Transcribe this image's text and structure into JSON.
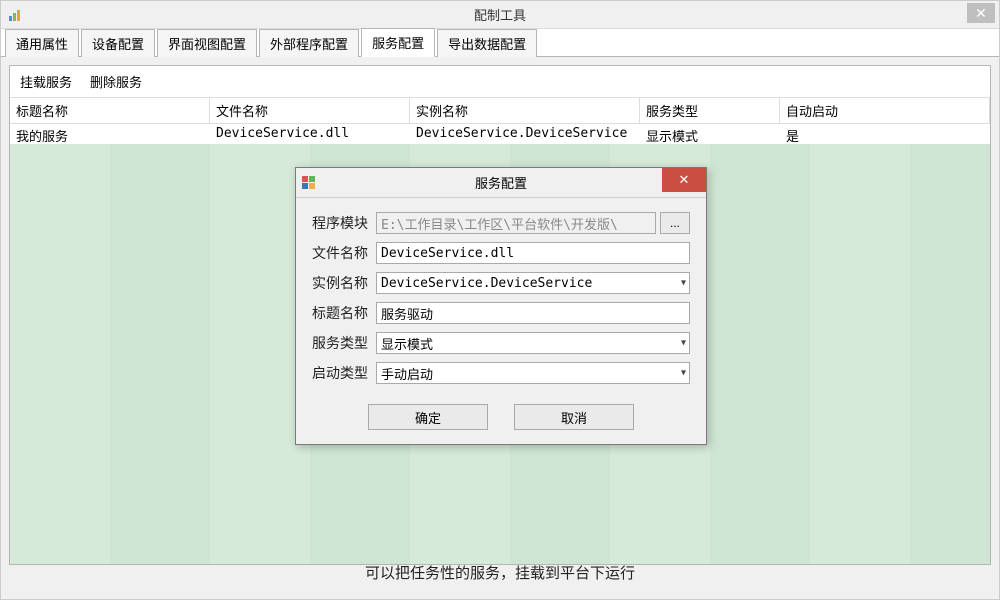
{
  "window": {
    "title": "配制工具"
  },
  "tabs": [
    {
      "label": "通用属性"
    },
    {
      "label": "设备配置"
    },
    {
      "label": "界面视图配置"
    },
    {
      "label": "外部程序配置"
    },
    {
      "label": "服务配置",
      "active": true
    },
    {
      "label": "导出数据配置"
    }
  ],
  "toolbar": {
    "mount": "挂载服务",
    "remove": "删除服务"
  },
  "grid": {
    "headers": {
      "title": "标题名称",
      "file": "文件名称",
      "instance": "实例名称",
      "type": "服务类型",
      "autostart": "自动启动"
    },
    "rows": [
      {
        "title": "我的服务",
        "file": "DeviceService.dll",
        "instance": "DeviceService.DeviceService",
        "type": "显示模式",
        "autostart": "是"
      }
    ]
  },
  "dialog": {
    "title": "服务配置",
    "labels": {
      "module": "程序模块",
      "file": "文件名称",
      "instance": "实例名称",
      "title": "标题名称",
      "type": "服务类型",
      "startup": "启动类型"
    },
    "values": {
      "module": "E:\\工作目录\\工作区\\平台软件\\开发版\\",
      "file": "DeviceService.dll",
      "instance": "DeviceService.DeviceService",
      "title": "服务驱动",
      "type": "显示模式",
      "startup": "手动启动"
    },
    "browse": "...",
    "ok": "确定",
    "cancel": "取消"
  },
  "footer": "可以把任务性的服务，挂载到平台下运行"
}
